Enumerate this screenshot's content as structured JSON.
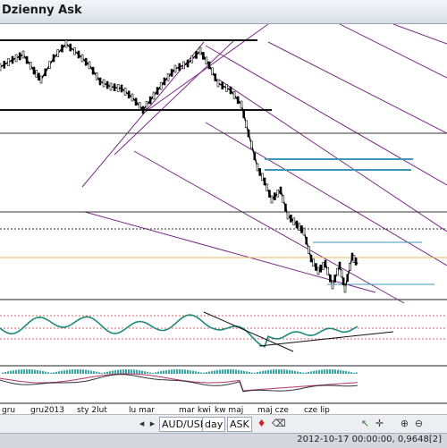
{
  "window": {
    "title": "Dzienny Ask"
  },
  "xaxis": {
    "labels": [
      "gru",
      "gru2013",
      "sty 2lut",
      "lu mar",
      "mar kwi",
      "kw maj",
      "maj cze",
      "cze lip"
    ]
  },
  "toolbar": {
    "symbol": "AUD/USD",
    "timeframe": "day",
    "price_side": "ASK"
  },
  "status": {
    "text": "2012-10-17 00:00:00, 0,9648[2]"
  },
  "colors": {
    "price": "#000000",
    "channel": "#7a2a86",
    "hline_black": "#111111",
    "hline_blue": "#3f96b6",
    "hline_orange": "#e6b866",
    "osc_line": "#1f8a7a",
    "macd_hist": "#3aa8a8",
    "macd_signal": "#b0306a"
  },
  "icons": [
    "chevron-left-icon",
    "chevron-right-icon",
    "zoom-in-icon",
    "zoom-out-icon",
    "crosshair-icon",
    "cursor-icon",
    "drawing-icon",
    "eraser-icon"
  ]
}
